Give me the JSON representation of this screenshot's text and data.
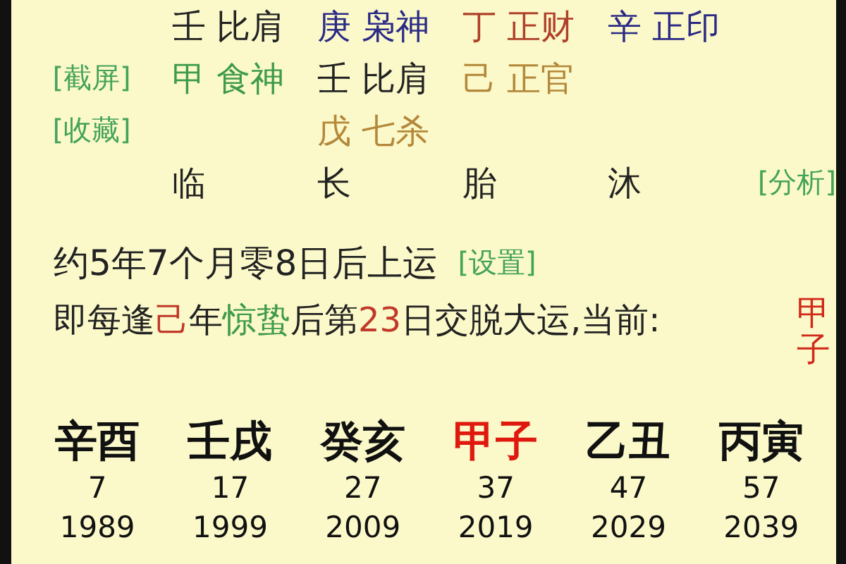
{
  "hidden_stems": [
    [
      {
        "stem": "壬",
        "god": "比肩",
        "color": "#222222"
      },
      {
        "stem": "甲",
        "god": "食神",
        "color": "#3f9a4c"
      }
    ],
    [
      {
        "stem": "庚",
        "god": "枭神",
        "color": "#2b2b86"
      },
      {
        "stem": "壬",
        "god": "比肩",
        "color": "#222222"
      },
      {
        "stem": "戊",
        "god": "七杀",
        "color": "#b4883a"
      }
    ],
    [
      {
        "stem": "丁",
        "god": "正财",
        "color": "#b0402a"
      },
      {
        "stem": "己",
        "god": "正官",
        "color": "#b4883a"
      }
    ],
    [
      {
        "stem": "辛",
        "god": "正印",
        "color": "#2b2b86"
      }
    ]
  ],
  "growth_stages": [
    "临",
    "长",
    "胎",
    "沐"
  ],
  "side_links": [
    "[截屏]",
    "[收藏]"
  ],
  "analyze_link": "[分析]",
  "start_text": "约5年7个月零8日后上运",
  "settings_link": "[设置]",
  "transition_text": [
    {
      "text": "即每逢",
      "color": "#222222"
    },
    {
      "text": "己",
      "color": "#c0392b"
    },
    {
      "text": "年",
      "color": "#222222"
    },
    {
      "text": "惊蛰",
      "color": "#3f9a4c"
    },
    {
      "text": "后第",
      "color": "#222222"
    },
    {
      "text": "23",
      "color": "#c0392b"
    },
    {
      "text": "日交脱大运,当前:",
      "color": "#222222"
    }
  ],
  "current_pillar": "甲子",
  "luck_pillars": [
    {
      "pillar": "辛酉",
      "age": "7",
      "year": "1989",
      "selected": false
    },
    {
      "pillar": "壬戌",
      "age": "17",
      "year": "1999",
      "selected": false
    },
    {
      "pillar": "癸亥",
      "age": "27",
      "year": "2009",
      "selected": false
    },
    {
      "pillar": "甲子",
      "age": "37",
      "year": "2019",
      "selected": true
    },
    {
      "pillar": "乙丑",
      "age": "47",
      "year": "2029",
      "selected": false
    },
    {
      "pillar": "丙寅",
      "age": "57",
      "year": "2039",
      "selected": false
    }
  ]
}
